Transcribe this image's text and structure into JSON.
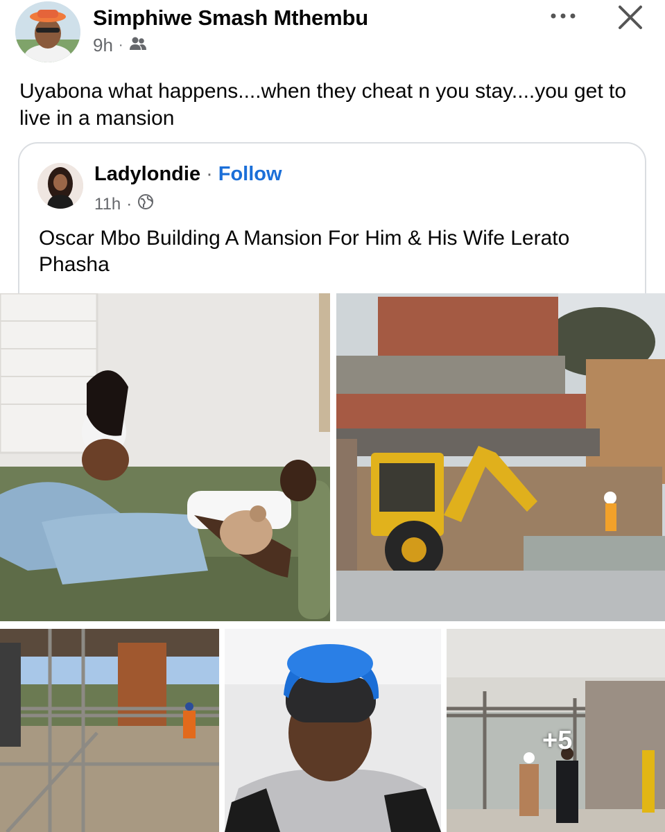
{
  "post": {
    "author": "Simphiwe Smash Mthembu",
    "time": "9h",
    "audience_icon": "friends-icon",
    "text": "Uyabona what happens....when they cheat n you stay....you get to live in a mansion",
    "more_icon": "•••",
    "close_icon": "close-icon"
  },
  "shared": {
    "author": "Ladylondie",
    "separator": "·",
    "follow_label": "Follow",
    "time": "11h",
    "audience_icon": "globe-icon",
    "text": "Oscar Mbo Building A Mansion For Him & His Wife Lerato Phasha"
  },
  "gallery": {
    "more_count": "+5",
    "photos": [
      "couple-photo",
      "construction-excavator-photo",
      "scaffolding-photo",
      "man-helmet-selfie-photo",
      "interior-construction-photo"
    ]
  },
  "colors": {
    "link": "#1b6fd8",
    "secondary_text": "#65676b",
    "card_border": "#dadde1"
  }
}
